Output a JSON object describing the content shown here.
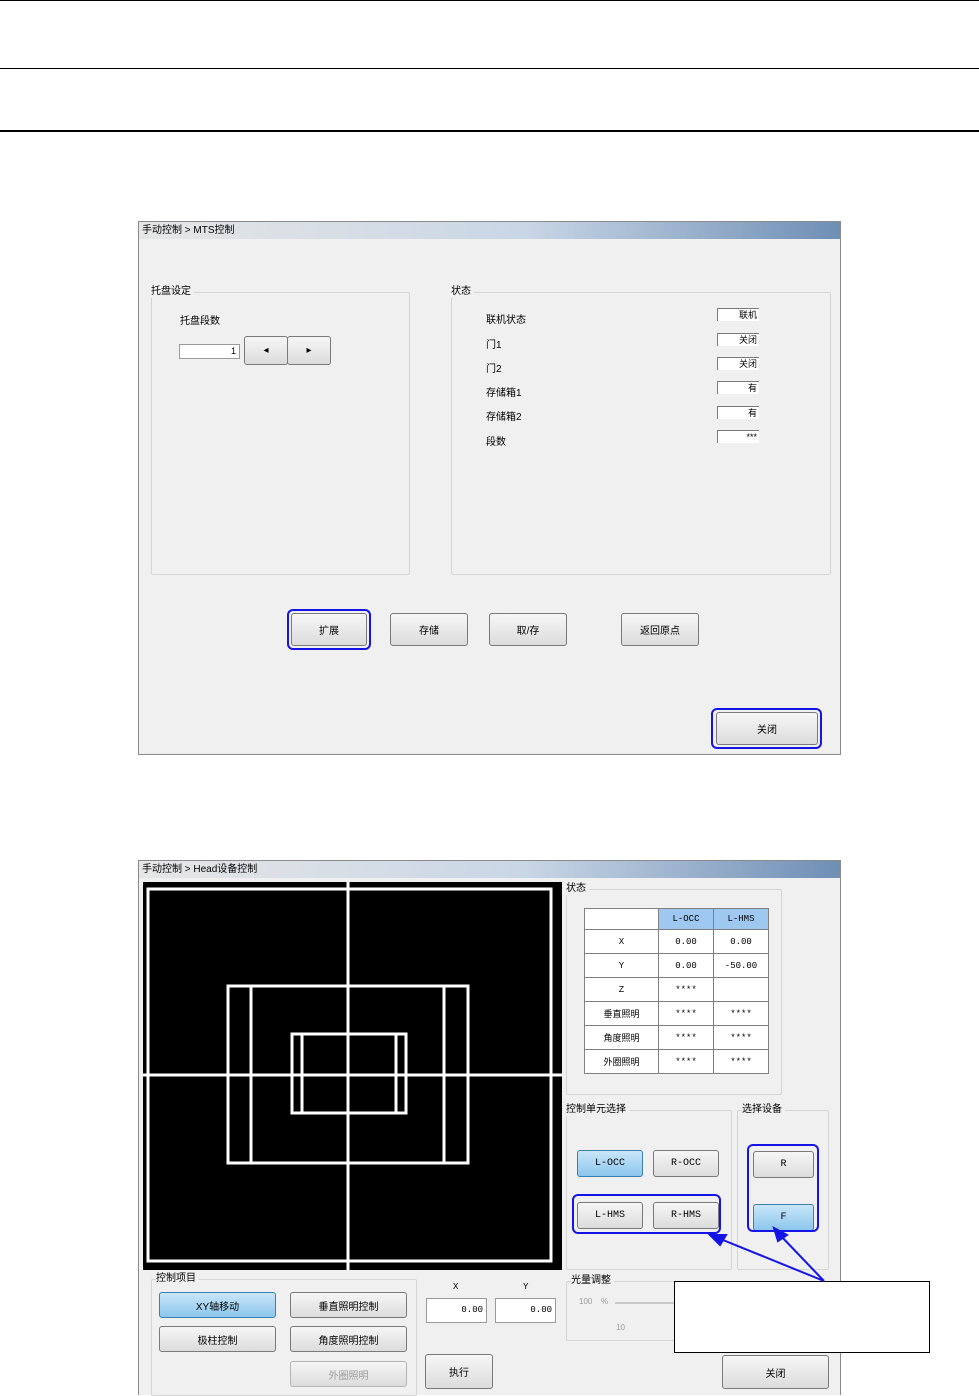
{
  "mts_dialog": {
    "title": "手动控制 > MTS控制",
    "tray_group_label": "托盘设定",
    "tray_stage_label": "托盘段数",
    "tray_stage_value": "1",
    "left_arrow": "◂",
    "right_arrow": "▸",
    "status_group_label": "状态",
    "status_items": [
      {
        "label": "联机状态",
        "value": "联机"
      },
      {
        "label": "门1",
        "value": "关闭"
      },
      {
        "label": "门2",
        "value": "关闭"
      },
      {
        "label": "存储箱1",
        "value": "有"
      },
      {
        "label": "存储箱2",
        "value": "有"
      },
      {
        "label": "段数",
        "value": "***"
      }
    ],
    "buttons": {
      "expand": "扩展",
      "store": "存储",
      "fetch": "取/存",
      "home": "返回原点",
      "close": "关闭"
    }
  },
  "head_dialog": {
    "title": "手动控制 > Head设备控制",
    "status_group_label": "状态",
    "table": {
      "columns": [
        "",
        "L-OCC",
        "L-HMS"
      ],
      "rows": [
        [
          "X",
          "0.00",
          "0.00"
        ],
        [
          "Y",
          "0.00",
          "-50.00"
        ],
        [
          "Z",
          "****",
          ""
        ],
        [
          "垂直照明",
          "****",
          "****"
        ],
        [
          "角度照明",
          "****",
          "****"
        ],
        [
          "外圈照明",
          "****",
          "****"
        ]
      ]
    },
    "unit_group_label": "控制单元选择",
    "unit_buttons": [
      "L-OCC",
      "R-OCC",
      "L-HMS",
      "R-HMS"
    ],
    "device_group_label": "选择设备",
    "device_buttons": [
      "R",
      "F"
    ],
    "ctrl_group_label": "控制项目",
    "ctrl_buttons": [
      "XY轴移动",
      "垂直照明控制",
      "极柱控制",
      "角度照明控制",
      "外圈照明"
    ],
    "x_label": "X",
    "y_label": "Y",
    "x_value": "0.00",
    "y_value": "0.00",
    "execute_label": "执行",
    "light_group_label": "光量调整",
    "light_max": "100",
    "light_unit": "%",
    "light_min": "10",
    "close_label": "关闭"
  },
  "colors": {
    "highlight": "#1414e6",
    "selected_button": "#8cc6ed",
    "table_header": "#9ec8ef"
  }
}
